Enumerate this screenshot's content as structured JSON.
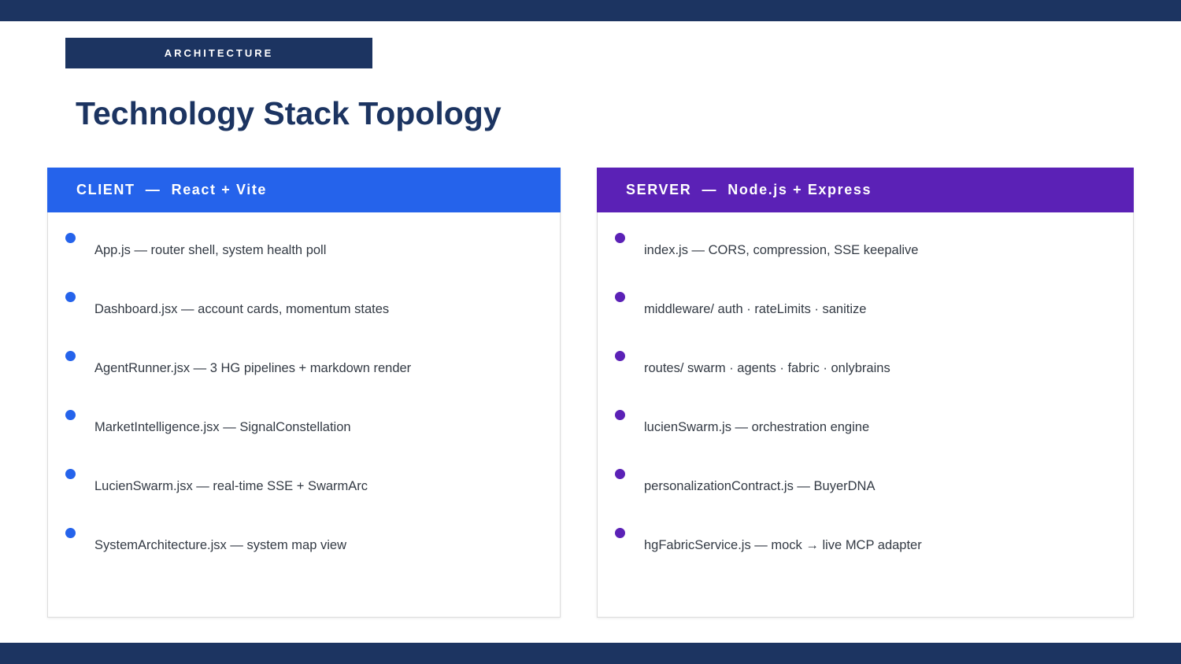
{
  "section_tag": "ARCHITECTURE",
  "title": "Technology Stack Topology",
  "colors": {
    "navy": "#1c3461",
    "client_accent": "#2563eb",
    "server_accent": "#5b21b6"
  },
  "client": {
    "header": "CLIENT  —  React + Vite",
    "items": [
      "App.js — router shell, system health poll",
      "Dashboard.jsx — account cards, momentum states",
      "AgentRunner.jsx — 3 HG pipelines + markdown render",
      "MarketIntelligence.jsx — SignalConstellation",
      "LucienSwarm.jsx — real-time SSE + SwarmArc",
      "SystemArchitecture.jsx — system map view"
    ]
  },
  "server": {
    "header": "SERVER  —  Node.js + Express",
    "items": [
      "index.js — CORS, compression, SSE keepalive",
      "middleware/ auth · rateLimits · sanitize",
      "routes/ swarm · agents · fabric · onlybrains",
      "lucienSwarm.js — orchestration engine",
      "personalizationContract.js — BuyerDNA",
      "hgFabricService.js — mock → live MCP adapter"
    ]
  }
}
